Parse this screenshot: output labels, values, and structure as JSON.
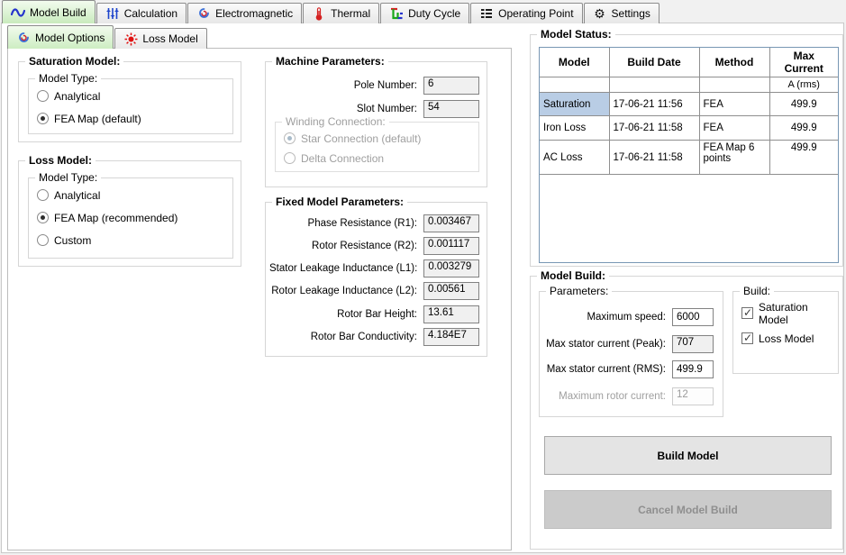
{
  "colors": {
    "active_tab_green": "#c9ebbd",
    "selected_cell_blue": "#b9cde5",
    "table_border_blue": "#7897b4",
    "readonly_field_gray": "#f0f0f0"
  },
  "main_tabs": {
    "items": [
      {
        "label": "Model Build",
        "icon": "wave-icon",
        "active": true
      },
      {
        "label": "Calculation",
        "icon": "sliders-icon",
        "active": false
      },
      {
        "label": "Electromagnetic",
        "icon": "coil-icon",
        "active": false
      },
      {
        "label": "Thermal",
        "icon": "thermometer-icon",
        "active": false
      },
      {
        "label": "Duty Cycle",
        "icon": "duty-cycle-icon",
        "active": false
      },
      {
        "label": "Operating Point",
        "icon": "list-icon",
        "active": false
      },
      {
        "label": "Settings",
        "icon": "gear-icon",
        "active": false
      }
    ]
  },
  "sub_tabs": {
    "items": [
      {
        "label": "Model Options",
        "icon": "coil-icon",
        "active": true
      },
      {
        "label": "Loss Model",
        "icon": "sun-icon",
        "active": false
      }
    ]
  },
  "saturation_model": {
    "title": "Saturation Model:",
    "model_type": {
      "title": "Model Type:",
      "options": [
        {
          "label": "Analytical",
          "selected": false
        },
        {
          "label": "FEA Map (default)",
          "selected": true
        }
      ]
    }
  },
  "loss_model": {
    "title": "Loss Model:",
    "model_type": {
      "title": "Model Type:",
      "options": [
        {
          "label": "Analytical",
          "selected": false
        },
        {
          "label": "FEA Map (recommended)",
          "selected": true
        },
        {
          "label": "Custom",
          "selected": false
        }
      ]
    }
  },
  "machine_parameters": {
    "title": "Machine Parameters:",
    "fields": [
      {
        "label": "Pole Number:",
        "value": "6"
      },
      {
        "label": "Slot Number:",
        "value": "54"
      }
    ],
    "winding_connection": {
      "title": "Winding Connection:",
      "options": [
        {
          "label": "Star Connection (default)",
          "selected": true,
          "disabled": true
        },
        {
          "label": "Delta Connection",
          "selected": false,
          "disabled": true
        }
      ]
    }
  },
  "fixed_model_parameters": {
    "title": "Fixed Model Parameters:",
    "fields": [
      {
        "label": "Phase Resistance (R1):",
        "value": "0.003467"
      },
      {
        "label": "Rotor Resistance (R2):",
        "value": "0.001117"
      },
      {
        "label": "Stator Leakage Inductance (L1):",
        "value": "0.003279"
      },
      {
        "label": "Rotor Leakage Inductance (L2):",
        "value": "0.00561"
      },
      {
        "label": "Rotor Bar Height:",
        "value": "13.61"
      },
      {
        "label": "Rotor Bar Conductivity:",
        "value": "4.184E7"
      }
    ]
  },
  "model_status": {
    "title": "Model Status:",
    "table": {
      "headers": [
        "Model",
        "Build Date",
        "Method",
        "Max Current"
      ],
      "units": "A (rms)",
      "rows": [
        {
          "model": "Saturation",
          "build_date": "17-06-21 11:56",
          "method": "FEA",
          "max_current": "499.9",
          "selected": true
        },
        {
          "model": "Iron Loss",
          "build_date": "17-06-21 11:58",
          "method": "FEA",
          "max_current": "499.9",
          "selected": false
        },
        {
          "model": "AC Loss",
          "build_date": "17-06-21 11:58",
          "method": "FEA Map 6 points",
          "max_current": "499.9",
          "selected": false
        }
      ]
    }
  },
  "model_build": {
    "title": "Model Build:",
    "parameters": {
      "title": "Parameters:",
      "fields": [
        {
          "label": "Maximum speed:",
          "value": "6000",
          "state": "editable"
        },
        {
          "label": "Max stator current (Peak):",
          "value": "707",
          "state": "readonly"
        },
        {
          "label": "Max stator current (RMS):",
          "value": "499.9",
          "state": "editable"
        },
        {
          "label": "Maximum rotor current:",
          "value": "12",
          "state": "disabled"
        }
      ]
    },
    "build": {
      "title": "Build:",
      "checkboxes": [
        {
          "label": "Saturation Model",
          "checked": true
        },
        {
          "label": "Loss Model",
          "checked": true
        }
      ]
    },
    "buttons": [
      {
        "label": "Build Model",
        "enabled": true
      },
      {
        "label": "Cancel Model Build",
        "enabled": false
      }
    ]
  }
}
